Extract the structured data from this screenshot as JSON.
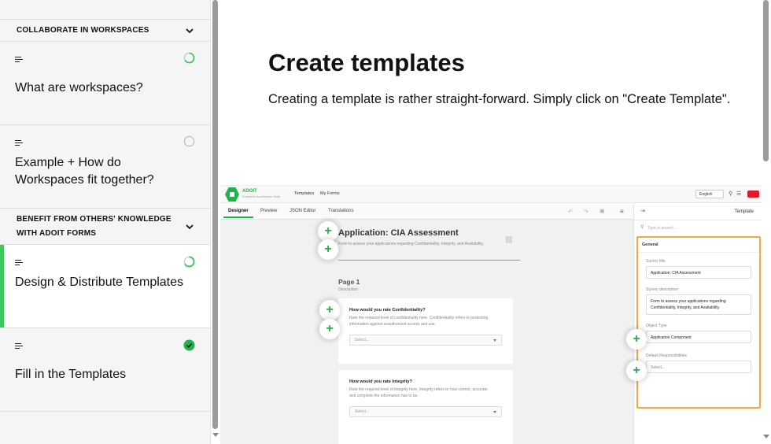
{
  "sidebar": {
    "sections": [
      {
        "title": "COLLABORATE IN WORKSPACES"
      },
      {
        "title": "BENEFIT FROM OTHERS' KNOWLEDGE WITH ADOIT FORMS"
      }
    ],
    "items": [
      {
        "label": "What are workspaces?",
        "status": "in-progress"
      },
      {
        "label": "Example + How do Workspaces fit together?",
        "status": "not-started"
      },
      {
        "label": "Design & Distribute Templates",
        "status": "in-progress",
        "active": true
      },
      {
        "label": "Fill in the Templates",
        "status": "completed"
      }
    ]
  },
  "content": {
    "heading": "Create templates",
    "paragraph": "Creating a template is rather straight-forward. Simply click on \"Create Template\"."
  },
  "screenshot": {
    "app_name": "ADOIT",
    "app_subtitle": "Enterprise Architecture Suite",
    "nav": [
      "Templates",
      "My Forms"
    ],
    "language": "English",
    "tabs": [
      "Designer",
      "Preview",
      "JSON Editor",
      "Translations"
    ],
    "form_title": "Application: CIA Assessment",
    "form_desc": "Form to assess your applications regarding Confidentiality, Integrity, and Availability.",
    "page_title": "Page 1",
    "page_desc": "Description",
    "questions": [
      {
        "title": "How would you rate Confidentiality?",
        "desc": "Rate the required level of confidentiality here. Confidentiality refers to protecting information against unauthorized access and use.",
        "placeholder": "Select..."
      },
      {
        "title": "How would you rate Integrity?",
        "desc": "Rate the required level of integrity here. Integrity refers to how correct, accurate and complete the information has to be.",
        "placeholder": "Select..."
      }
    ],
    "panel": {
      "title": "Template",
      "search_placeholder": "Type to search...",
      "group": "General",
      "survey_title_label": "Survey title",
      "survey_title_value": "Application: CIA Assessment",
      "survey_desc_label": "Survey description",
      "survey_desc_value": "Form to assess your applications regarding Confidentiality, Integrity, and Availability.",
      "object_type_label": "Object Type",
      "object_type_value": "Application Component",
      "resp_label": "Default Responsibilities",
      "resp_value": "Select..."
    }
  },
  "colors": {
    "accent": "#22b24c",
    "progress": "#3cc85a",
    "highlight": "#f4a93c"
  }
}
